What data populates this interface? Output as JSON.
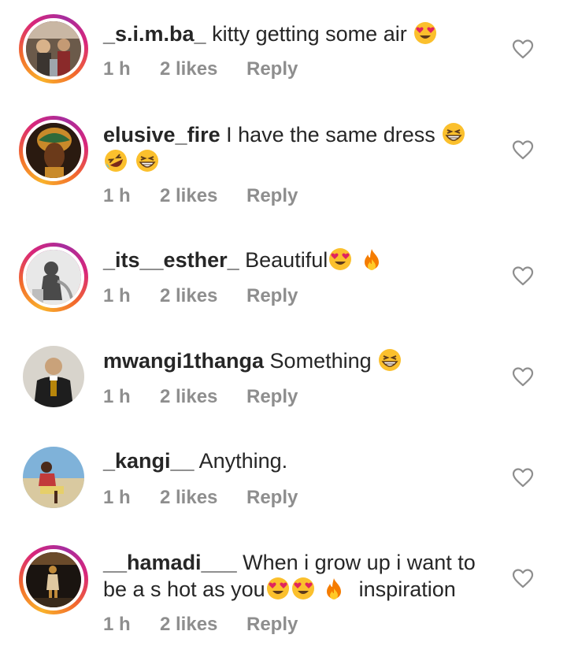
{
  "comments": [
    {
      "username": "_s.i.m.ba_",
      "text": "kitty getting some air",
      "text2": "",
      "time": "1 h",
      "likes": "2 likes",
      "reply": "Reply",
      "avatar_colors": [
        "#6b5a4a",
        "#c9b7a4",
        "#3b3530"
      ]
    },
    {
      "username": "elusive_fire",
      "text": "I have the same dress",
      "text2": "",
      "time": "1 h",
      "likes": "2 likes",
      "reply": "Reply",
      "avatar_colors": [
        "#2a1a10",
        "#c98a2a",
        "#6b3a1a"
      ]
    },
    {
      "username": "_its__esther_",
      "text": "Beautiful",
      "text2": "",
      "time": "1 h",
      "likes": "2 likes",
      "reply": "Reply",
      "avatar_colors": [
        "#e8e8e8",
        "#4a4a4a",
        "#9a9a9a"
      ]
    },
    {
      "username": "mwangi1thanga",
      "text": "Something",
      "text2": "",
      "time": "1 h",
      "likes": "2 likes",
      "reply": "Reply",
      "avatar_colors": [
        "#d8d4cc",
        "#1e1e1e",
        "#c9a27a"
      ]
    },
    {
      "username": "_kangi__",
      "text": "Anything.",
      "text2": "",
      "time": "1 h",
      "likes": "2 likes",
      "reply": "Reply",
      "avatar_colors": [
        "#7fb2d9",
        "#d9c9a0",
        "#c23a3a"
      ]
    },
    {
      "username": "__hamadi___",
      "text": "When i grow up i want to",
      "text2": "be a s hot as you",
      "text3": "inspiration",
      "time": "1 h",
      "likes": "2 likes",
      "reply": "Reply",
      "avatar_colors": [
        "#1a1410",
        "#c08a3a",
        "#e0c8a0"
      ]
    }
  ],
  "icons": {
    "heart": "heart-outline-icon",
    "heart_eyes": "smiling-face-with-heart-eyes",
    "grin": "grinning-squinting-face",
    "rofl": "rolling-on-the-floor-laughing",
    "fire": "fire"
  },
  "colors": {
    "text": "#262626",
    "meta": "#8e8e8e",
    "story_ring_start": "#f9b22b",
    "story_ring_end": "#a62d9e",
    "emoji_yellow": "#fbc02d",
    "heart_red": "#e0245e",
    "fire_orange": "#f57c00"
  }
}
